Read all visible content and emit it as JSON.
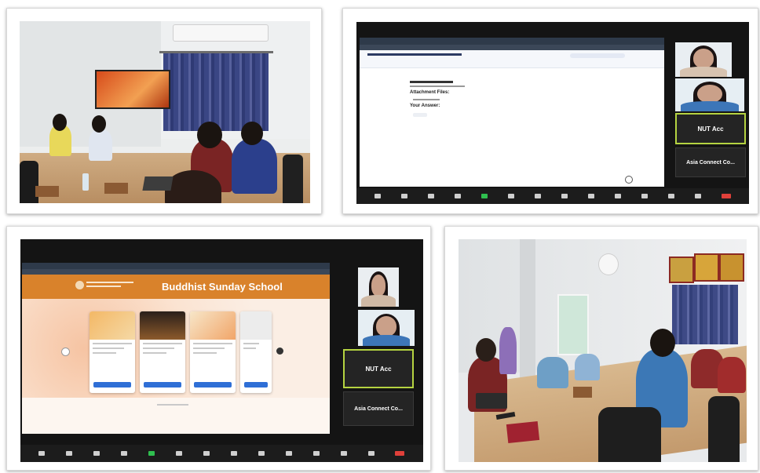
{
  "panels": [
    {
      "id": "classroom-photo-1",
      "kind": "photo"
    },
    {
      "id": "zoom-screenshot-form",
      "kind": "screenshot"
    },
    {
      "id": "zoom-screenshot-sunday-school",
      "kind": "screenshot"
    },
    {
      "id": "classroom-photo-2",
      "kind": "photo"
    }
  ],
  "zoom_form": {
    "attachment_heading": "Attachment Files:",
    "your_answer_heading": "Your Answer:",
    "tile_active_label": "NUT Acc",
    "tile_org_label": "Asia Connect Co..."
  },
  "zoom_site": {
    "site_title": "Buddhist Sunday School",
    "tile_active_label": "NUT Acc",
    "tile_org_label": "Asia Connect Co..."
  },
  "colors": {
    "zoom_dark": "#1c1c1c",
    "site_header": "#d9822b",
    "active_tile_border": "#b5d341",
    "wall": "#e9ecef",
    "table_wood": "#caa57c",
    "curtain": "#3e4a86"
  }
}
